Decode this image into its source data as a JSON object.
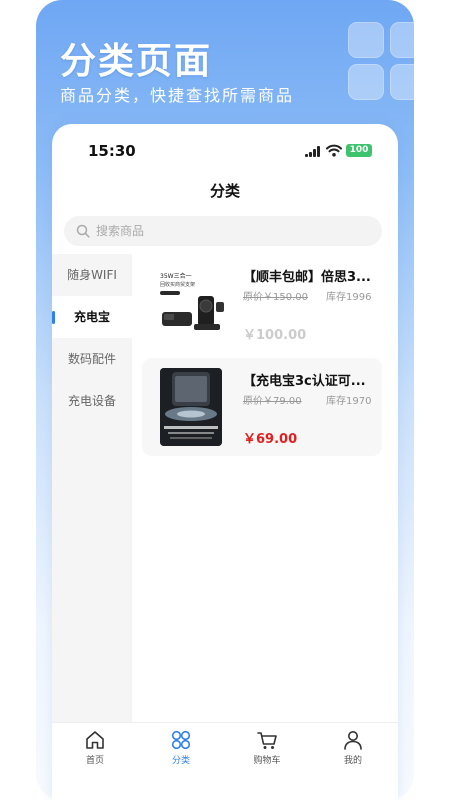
{
  "promo": {
    "title": "分类页面",
    "subtitle": "商品分类，快捷查找所需商品"
  },
  "status_bar": {
    "time": "15:30",
    "battery": "100"
  },
  "page": {
    "title": "分类"
  },
  "search": {
    "placeholder": "搜索商品",
    "value": ""
  },
  "categories": [
    {
      "label": "随身WIFI",
      "active": false
    },
    {
      "label": "充电宝",
      "active": true
    },
    {
      "label": "数码配件",
      "active": false
    },
    {
      "label": "充电设备",
      "active": false
    }
  ],
  "products": [
    {
      "name": "【顺丰包邮】倍思3...",
      "original_price": "原价￥150.00",
      "stock": "库存1996",
      "price": "￥100.00",
      "thumb_text": [
        "35W三合一",
        "回收买商贸支架"
      ]
    },
    {
      "name": "【充电宝3c认证可...",
      "original_price": "原价￥79.00",
      "stock": "库存1970",
      "price": "￥69.00"
    }
  ],
  "tabs": [
    {
      "label": "首页",
      "icon": "home-icon",
      "active": false
    },
    {
      "label": "分类",
      "icon": "category-icon",
      "active": true
    },
    {
      "label": "购物车",
      "icon": "cart-icon",
      "active": false
    },
    {
      "label": "我的",
      "icon": "user-icon",
      "active": false
    }
  ],
  "colors": {
    "accent": "#2f80ed",
    "price_red": "#e01f1f",
    "battery_green": "#3ec46d"
  }
}
